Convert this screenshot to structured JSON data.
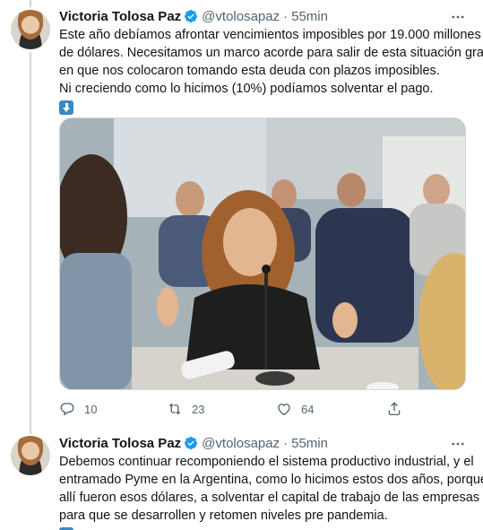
{
  "tweets": [
    {
      "author_name": "Victoria Tolosa Paz",
      "handle": "@vtolosapaz",
      "separator": "·",
      "time": "55min",
      "lines": [
        "Este año debíamos afrontar vencimientos imposibles por 19.000 millones",
        "de dólares. Necesitamos un marco acorde para salir de esta situación grave",
        "en que nos colocaron tomando esta deuda con plazos imposibles.",
        "Ni creciendo como lo hicimos (10%) podíamos solventar el pago."
      ],
      "emoji": "down-arrow-emoji",
      "media": "photo",
      "stats": {
        "replies": "10",
        "retweets": "23",
        "likes": "64"
      }
    },
    {
      "author_name": "Victoria Tolosa Paz",
      "handle": "@vtolosapaz",
      "separator": "·",
      "time": "55min",
      "lines": [
        "Debemos continuar recomponiendo el sistema productivo industrial, y el",
        "entramado Pyme en la Argentina, como lo hicimos estos dos años, porque",
        "allí fueron esos dólares, a solventar el capital de trabajo de las empresas",
        "para que se desarrollen y retomen niveles pre pandemia."
      ],
      "emoji": "down-arrow-emoji"
    }
  ],
  "icons": {
    "verified": "verified-badge-icon",
    "more": "more-options-icon",
    "reply": "reply-icon",
    "retweet": "retweet-icon",
    "like": "like-icon",
    "share": "share-icon"
  },
  "colors": {
    "verified": "#1d9bf0",
    "secondary_text": "#536471",
    "primary_text": "#0f1419",
    "thread_line": "#cfd9de",
    "emoji_blue": "#3b88c3"
  }
}
